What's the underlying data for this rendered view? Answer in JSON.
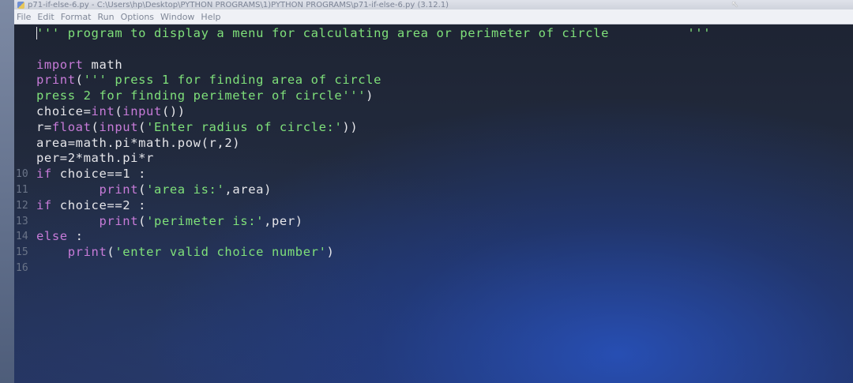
{
  "window": {
    "title": "p71-if-else-6.py - C:\\Users\\hp\\Desktop\\PYTHON PROGRAMS\\1)PYTHON PROGRAMS\\p71-if-else-6.py (3.12.1)"
  },
  "menubar": {
    "items": [
      "File",
      "Edit",
      "Format",
      "Run",
      "Options",
      "Window",
      "Help"
    ]
  },
  "editor": {
    "line_numbers": [
      "",
      "",
      "",
      "",
      "",
      "",
      "",
      "",
      "",
      "10",
      "11",
      "12",
      "13",
      "14",
      "15",
      "16"
    ],
    "lines": [
      [
        {
          "c": "str",
          "t": "''' program to display a menu for calculating area or perimeter of circle          '''"
        }
      ],
      [],
      [
        {
          "c": "kw",
          "t": "import"
        },
        {
          "c": "txt",
          "t": " math"
        }
      ],
      [
        {
          "c": "kw",
          "t": "print"
        },
        {
          "c": "txt",
          "t": "("
        },
        {
          "c": "str",
          "t": "''' press 1 for finding area of circle"
        }
      ],
      [
        {
          "c": "str",
          "t": "press 2 for finding perimeter of circle'''"
        },
        {
          "c": "txt",
          "t": ")"
        }
      ],
      [
        {
          "c": "txt",
          "t": "choice="
        },
        {
          "c": "kw",
          "t": "int"
        },
        {
          "c": "txt",
          "t": "("
        },
        {
          "c": "kw",
          "t": "input"
        },
        {
          "c": "txt",
          "t": "())"
        }
      ],
      [
        {
          "c": "txt",
          "t": "r="
        },
        {
          "c": "kw",
          "t": "float"
        },
        {
          "c": "txt",
          "t": "("
        },
        {
          "c": "kw",
          "t": "input"
        },
        {
          "c": "txt",
          "t": "("
        },
        {
          "c": "str",
          "t": "'Enter radius of circle:'"
        },
        {
          "c": "txt",
          "t": "))"
        }
      ],
      [
        {
          "c": "txt",
          "t": "area=math.pi*math.pow(r,2)"
        }
      ],
      [
        {
          "c": "txt",
          "t": "per=2*math.pi*r"
        }
      ],
      [
        {
          "c": "kw",
          "t": "if"
        },
        {
          "c": "txt",
          "t": " choice==1 :"
        }
      ],
      [
        {
          "c": "txt",
          "t": "        "
        },
        {
          "c": "kw",
          "t": "print"
        },
        {
          "c": "txt",
          "t": "("
        },
        {
          "c": "str",
          "t": "'area is:'"
        },
        {
          "c": "txt",
          "t": ",area)"
        }
      ],
      [
        {
          "c": "kw",
          "t": "if"
        },
        {
          "c": "txt",
          "t": " choice==2 :"
        }
      ],
      [
        {
          "c": "txt",
          "t": "        "
        },
        {
          "c": "kw",
          "t": "print"
        },
        {
          "c": "txt",
          "t": "("
        },
        {
          "c": "str",
          "t": "'perimeter is:'"
        },
        {
          "c": "txt",
          "t": ",per)"
        }
      ],
      [
        {
          "c": "kw",
          "t": "else"
        },
        {
          "c": "txt",
          "t": " :"
        }
      ],
      [
        {
          "c": "txt",
          "t": "    "
        },
        {
          "c": "kw",
          "t": "print"
        },
        {
          "c": "txt",
          "t": "("
        },
        {
          "c": "str",
          "t": "'enter valid choice number'"
        },
        {
          "c": "txt",
          "t": ")"
        }
      ],
      []
    ]
  },
  "colors": {
    "keyword": "#c77bd8",
    "string": "#7fe07a",
    "text": "#e6e6ea",
    "background": "#222b3f"
  },
  "icons": [
    "python-app-icon",
    "mouse-cursor-icon"
  ]
}
